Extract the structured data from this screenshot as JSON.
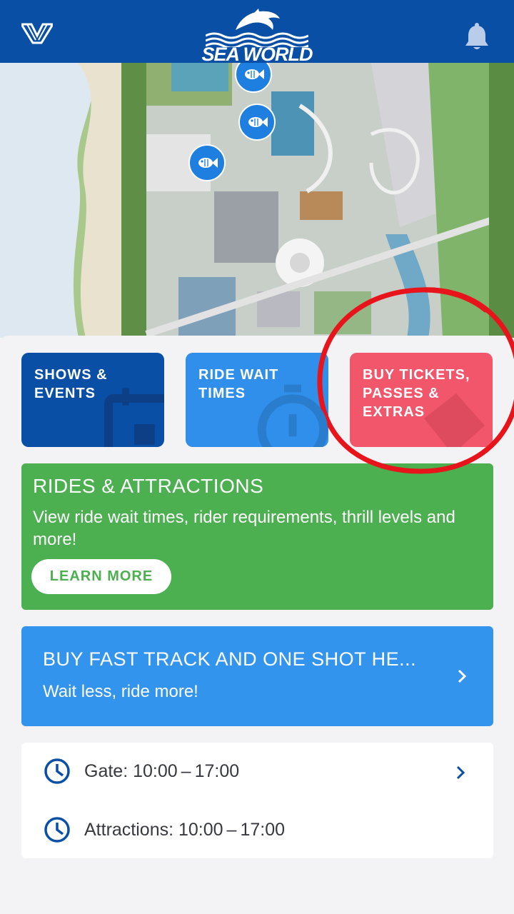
{
  "header": {
    "brand_text": "SEA WORLD",
    "left_icon": "village-logo-icon",
    "right_icon": "bell-icon"
  },
  "map": {
    "markers": [
      "fish-icon",
      "fish-icon",
      "fish-icon"
    ]
  },
  "tiles": [
    {
      "label": "SHOWS &\nEVENTS",
      "color": "#0a4fa6",
      "icon": "calendar-icon"
    },
    {
      "label": "RIDE WAIT\nTIMES",
      "color": "#2f8fea",
      "icon": "stopwatch-icon"
    },
    {
      "label": "BUY TICKETS,\nPASSES &\nEXTRAS",
      "color": "#f2566b",
      "icon": "ticket-icon"
    }
  ],
  "rides_card": {
    "title": "RIDES & ATTRACTIONS",
    "description": "View ride wait times, rider requirements, thrill levels and more!",
    "button_label": "LEARN MORE",
    "color": "#4caf50"
  },
  "fast_track_card": {
    "title": "BUY FAST TRACK AND ONE SHOT HE...",
    "subtitle": "Wait less, ride more!",
    "color": "#3394ee"
  },
  "hours": {
    "gate": "Gate: 10:00 – 17:00",
    "attractions": "Attractions: 10:00 – 17:00"
  },
  "colors": {
    "header": "#0a4fa6",
    "annotation": "#e8141c"
  }
}
